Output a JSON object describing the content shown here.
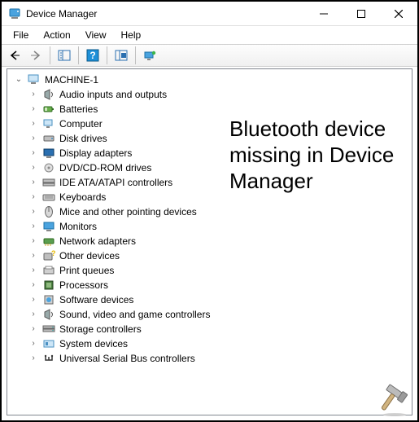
{
  "window": {
    "title": "Device Manager"
  },
  "menu": {
    "items": [
      "File",
      "Action",
      "View",
      "Help"
    ]
  },
  "tree": {
    "root": "MACHINE-1",
    "children": [
      "Audio inputs and outputs",
      "Batteries",
      "Computer",
      "Disk drives",
      "Display adapters",
      "DVD/CD-ROM drives",
      "IDE ATA/ATAPI controllers",
      "Keyboards",
      "Mice and other pointing devices",
      "Monitors",
      "Network adapters",
      "Other devices",
      "Print queues",
      "Processors",
      "Software devices",
      "Sound, video and game controllers",
      "Storage controllers",
      "System devices",
      "Universal Serial Bus controllers"
    ]
  },
  "annotation": "Bluetooth device missing in Device Manager"
}
